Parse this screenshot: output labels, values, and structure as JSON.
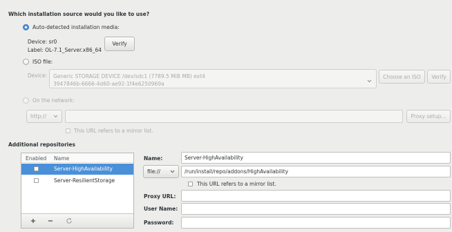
{
  "heading": "Which installation source would you like to use?",
  "sources": {
    "auto": {
      "label": "Auto-detected installation media:",
      "selected": true,
      "device": "Device: sr0",
      "media_label": "Label: OL-7.1_Server.x86_64",
      "verify": "Verify"
    },
    "iso": {
      "label": "ISO file:",
      "selected": false,
      "device_label": "Device:",
      "device_name": "Generic STORAGE DEVICE /dev/sdc1 (7789.5 MiB MB) ext4",
      "device_uuid": "3947846b-6666-4d60-ae92-1f4e6250969a",
      "choose": "Choose an ISO",
      "verify": "Verify"
    },
    "network": {
      "label": "On the network:",
      "selected": false,
      "protocol": "http://",
      "url": "",
      "proxy_setup": "Proxy setup...",
      "mirror_list": "This URL refers to a mirror list.",
      "mirror_checked": false
    }
  },
  "additional": {
    "heading": "Additional repositories",
    "columns": {
      "enabled": "Enabled",
      "name": "Name"
    },
    "repos": [
      {
        "name": "Server-HighAvailability",
        "enabled": false,
        "selected": true
      },
      {
        "name": "Server-ResilientStorage",
        "enabled": false,
        "selected": false
      }
    ],
    "toolbar": {
      "add": "+",
      "remove": "−"
    }
  },
  "repo_form": {
    "name_label": "Name:",
    "name": "Server-HighAvailability",
    "protocol": "file://",
    "url": "/run/install/repo/addons/HighAvailability",
    "mirror_list": "This URL refers to a mirror list.",
    "mirror_checked": false,
    "proxy_label": "Proxy URL:",
    "proxy": "",
    "user_label": "User Name:",
    "user": "",
    "password_label": "Password:",
    "password": ""
  },
  "icons": {
    "dropdown": "chevron-down-icon",
    "refresh": "refresh-icon"
  },
  "colors": {
    "window_bg": "#ededeb",
    "text": "#2e3436",
    "disabled_text": "#a8abab",
    "accent": "#4a90d9",
    "input_bg": "#ffffff",
    "border": "#b7b8b5"
  }
}
